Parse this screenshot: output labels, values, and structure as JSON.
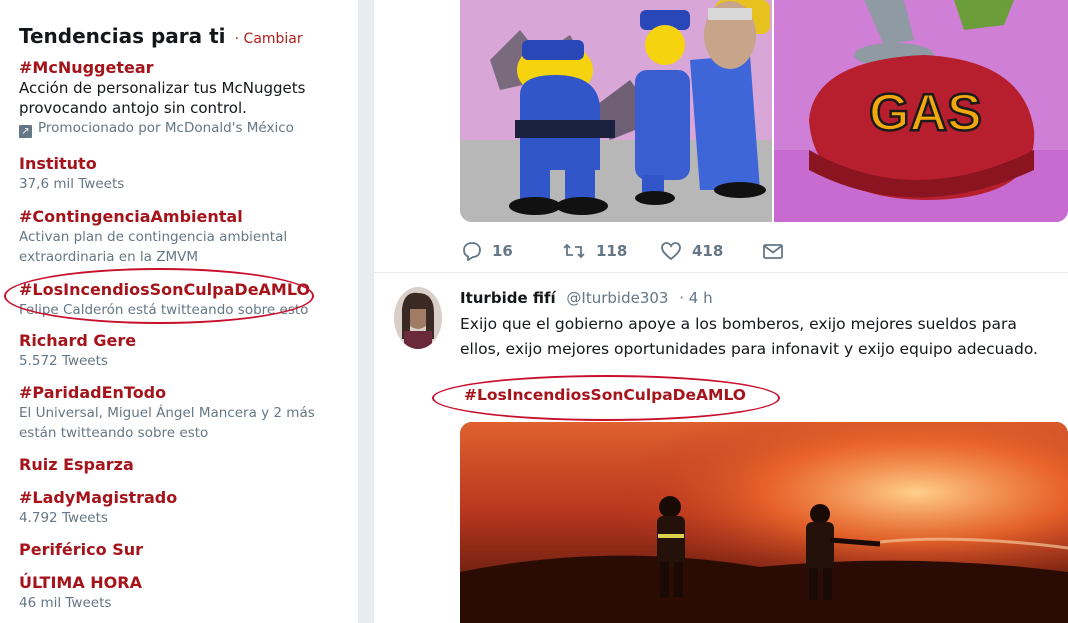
{
  "trends": {
    "title": "Tendencias para ti",
    "change_link": "· Cambiar",
    "items": [
      {
        "name": "#McNuggetear",
        "desc": "Acción de personalizar tus McNuggets provocando antojo sin control.",
        "promo": "Promocionado por McDonald's México"
      },
      {
        "name": "Instituto",
        "desc": "37,6 mil Tweets"
      },
      {
        "name": "#ContingenciaAmbiental",
        "desc": "Activan plan de contingencia ambiental extraordinaria en la ZMVM"
      },
      {
        "name": "#LosIncendiosSonCulpaDeAMLO",
        "desc": "Felipe Calderón está twitteando sobre esto"
      },
      {
        "name": "Richard Gere",
        "desc": "5.572 Tweets"
      },
      {
        "name": "#ParidadEnTodo",
        "desc": "El Universal, Miguel Ángel Mancera y 2 más están twitteando sobre esto"
      },
      {
        "name": "Ruiz Esparza",
        "desc": ""
      },
      {
        "name": "#LadyMagistrado",
        "desc": "4.792 Tweets"
      },
      {
        "name": "Periférico Sur",
        "desc": ""
      },
      {
        "name": "ÚLTIMA HORA",
        "desc": "46 mil Tweets"
      }
    ]
  },
  "top_tweet": {
    "gas_text": "GAS",
    "actions": {
      "replies": "16",
      "retweets": "118",
      "likes": "418"
    }
  },
  "tweet": {
    "author_name": "Iturbide fifí",
    "handle": "@Iturbide303",
    "time": "· 4 h",
    "text": "Exijo que el gobierno apoye a los bomberos, exijo mejores sueldos para ellos, exijo mejores oportunidades para infonavit y exijo equipo adecuado.",
    "hashtag": "#LosIncendiosSonCulpaDeAMLO"
  },
  "colors": {
    "trend_red": "#a5131b",
    "highlight_ellipse": "#c8102e",
    "muted": "#657786"
  },
  "icons": [
    "promoted-icon",
    "reply-icon",
    "retweet-icon",
    "like-icon",
    "message-icon"
  ]
}
